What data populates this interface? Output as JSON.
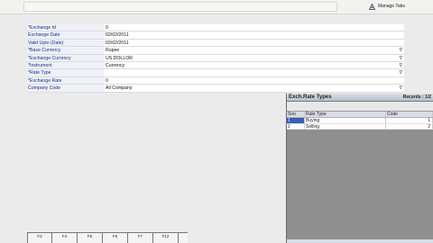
{
  "toolbar": {
    "manage_tabs_label": "Manage Tabs"
  },
  "form": {
    "rows": [
      {
        "label": "*Exchange Id",
        "value": "0",
        "dropdown": false
      },
      {
        "label": "Exchange Date",
        "value": "02/02/2011",
        "dropdown": false
      },
      {
        "label": "Valid Upto (Date)",
        "value": "02/02/2011",
        "dropdown": false
      },
      {
        "label": "*Base Currency",
        "value": "Rupee",
        "dropdown": true
      },
      {
        "label": "*Exchange Currency",
        "value": "US DOLLOR",
        "dropdown": true
      },
      {
        "label": "*Instrument",
        "value": "Currency",
        "dropdown": true
      },
      {
        "label": "*Rate Type",
        "value": "",
        "dropdown": true
      },
      {
        "label": "*Exchange Rate",
        "value": "0",
        "dropdown": false
      },
      {
        "label": "Company Code",
        "value": "All Company",
        "dropdown": true
      }
    ]
  },
  "lookup": {
    "title": "Exch.Rate Types",
    "records": "Records : 1/2",
    "columns": [
      "Sno",
      "Rate Type",
      "Code"
    ],
    "rows": [
      {
        "sno": "1",
        "rate_type": "Buying",
        "code": "1"
      },
      {
        "sno": "2",
        "rate_type": "Selling",
        "code": "2"
      }
    ]
  },
  "function_keys": [
    "F3",
    "F4",
    "F5",
    "F6",
    "F7",
    "F12"
  ],
  "icons": {
    "manage_tabs": "tabs-icon",
    "dropdown": "dropdown-arrow-icon"
  }
}
